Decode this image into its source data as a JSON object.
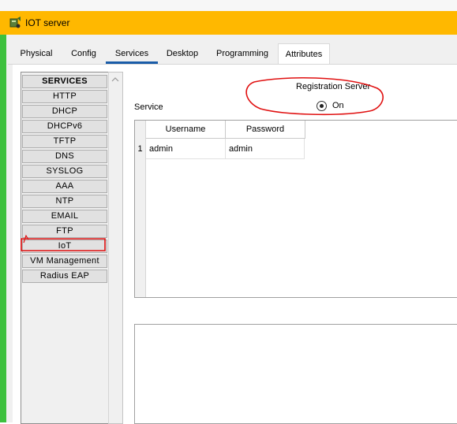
{
  "window": {
    "title": "IOT server"
  },
  "tabs": [
    {
      "label": "Physical"
    },
    {
      "label": "Config"
    },
    {
      "label": "Services"
    },
    {
      "label": "Desktop"
    },
    {
      "label": "Programming"
    },
    {
      "label": "Attributes"
    }
  ],
  "active_tab": "Services",
  "sidebar": {
    "header": "SERVICES",
    "items": [
      {
        "label": "HTTP"
      },
      {
        "label": "DHCP"
      },
      {
        "label": "DHCPv6"
      },
      {
        "label": "TFTP"
      },
      {
        "label": "DNS"
      },
      {
        "label": "SYSLOG"
      },
      {
        "label": "AAA"
      },
      {
        "label": "NTP"
      },
      {
        "label": "EMAIL"
      },
      {
        "label": "FTP"
      },
      {
        "label": "IoT"
      },
      {
        "label": "VM Management"
      },
      {
        "label": "Radius EAP"
      }
    ],
    "selected": "IoT"
  },
  "panel": {
    "title": "Registration Server",
    "service_label": "Service",
    "service_option": "On",
    "service_checked": true
  },
  "users_table": {
    "columns": [
      "Username",
      "Password"
    ],
    "rows": [
      {
        "index": "1",
        "username": "admin",
        "password": "admin"
      }
    ]
  },
  "colors": {
    "titlebar_accent": "#ffb800",
    "active_tab_underline": "#1a5ca8",
    "annotation": "#e01010"
  }
}
